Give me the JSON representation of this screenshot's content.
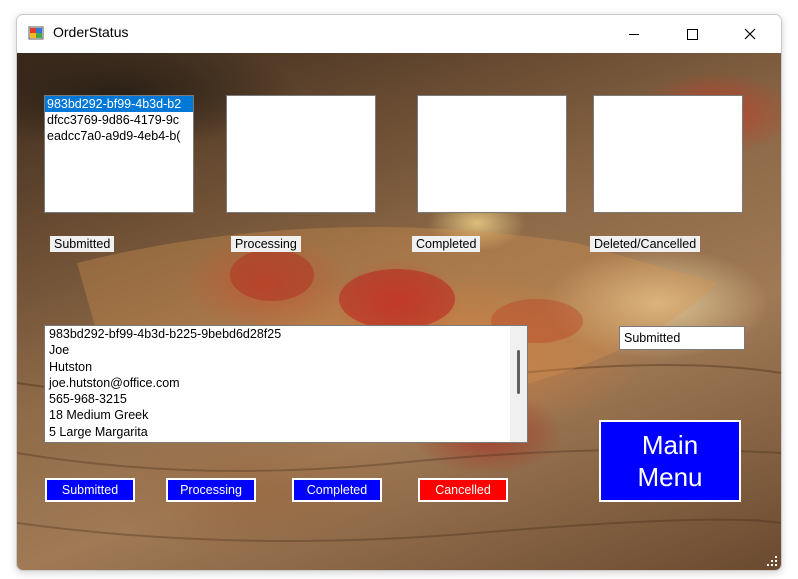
{
  "window": {
    "title": "OrderStatus"
  },
  "lists": {
    "submitted": [
      "983bd292-bf99-4b3d-b2",
      "dfcc3769-9d86-4179-9c",
      "eadcc7a0-a9d9-4eb4-b("
    ],
    "processing": [],
    "completed": [],
    "deleted_cancelled": []
  },
  "labels": {
    "submitted": "Submitted",
    "processing": "Processing",
    "completed": "Completed",
    "deleted_cancelled": "Deleted/Cancelled"
  },
  "order_detail": {
    "lines": [
      "983bd292-bf99-4b3d-b225-9bebd6d28f25",
      "Joe",
      "Hutston",
      "joe.hutston@office.com",
      "565-968-3215",
      "18 Medium Greek",
      "5 Large Margarita"
    ]
  },
  "status_box": {
    "value": "Submitted"
  },
  "buttons": {
    "submitted": "Submitted",
    "processing": "Processing",
    "completed": "Completed",
    "cancelled": "Cancelled",
    "main_menu_line1": "Main",
    "main_menu_line2": "Menu"
  },
  "icons": {
    "app": "app-icon",
    "minimize": "minimize-icon",
    "maximize": "maximize-icon",
    "close": "close-icon",
    "resize": "resize-grip-icon"
  },
  "colors": {
    "button_blue": "#0000ff",
    "button_red": "#ff0000",
    "selection": "#0078d7"
  }
}
